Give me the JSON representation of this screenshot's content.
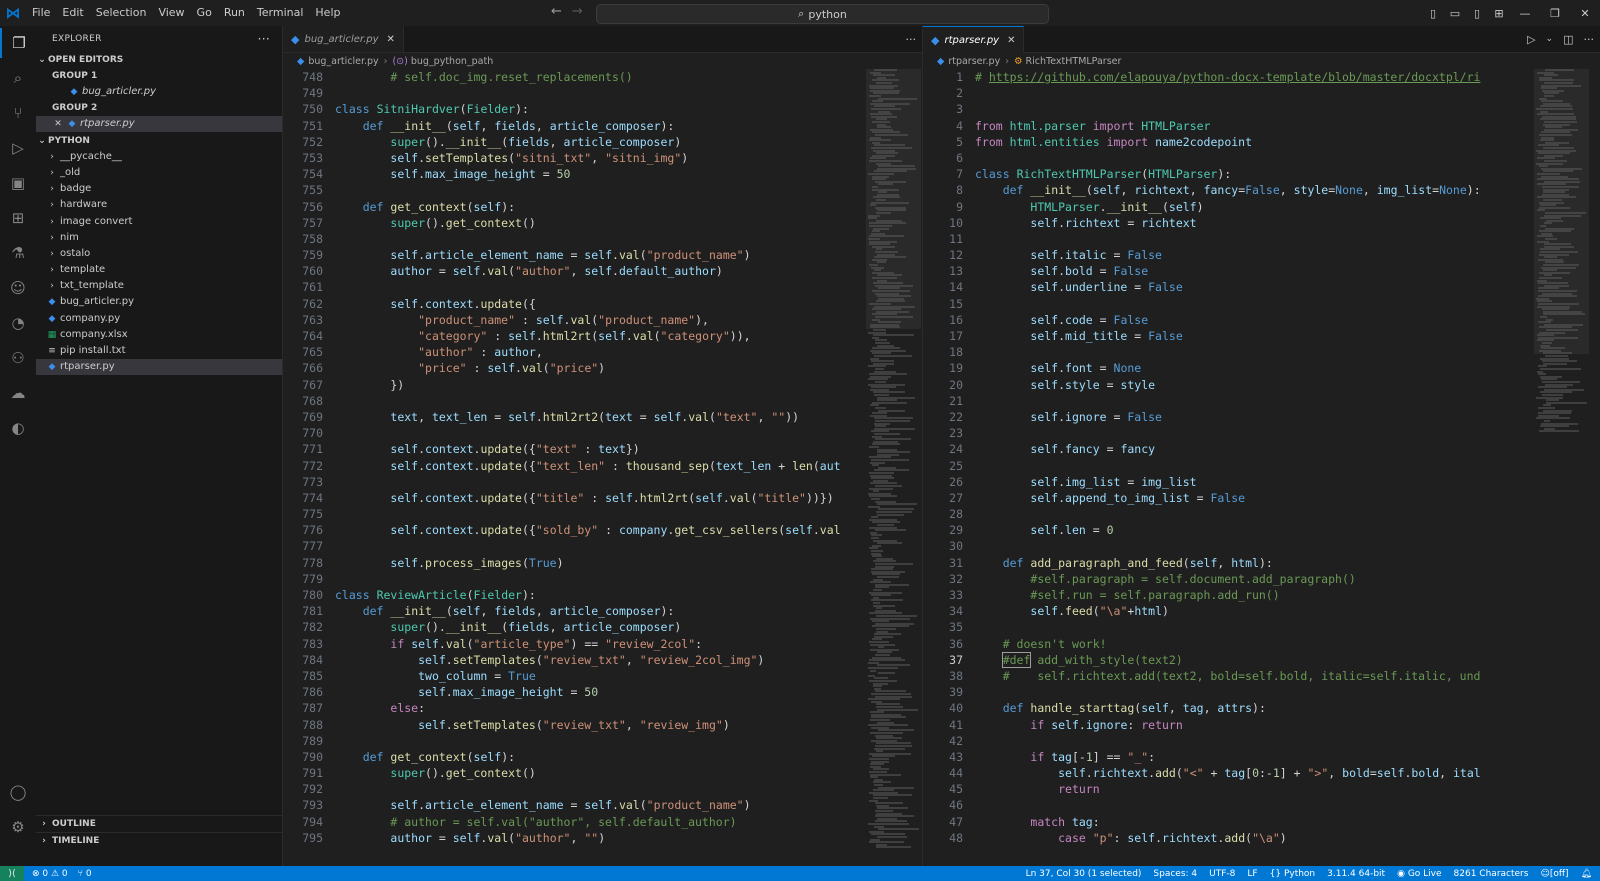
{
  "titlebar": {
    "menus": [
      "File",
      "Edit",
      "Selection",
      "View",
      "Go",
      "Run",
      "Terminal",
      "Help"
    ],
    "search": "python"
  },
  "sidebar": {
    "header": "EXPLORER",
    "open_editors": "OPEN EDITORS",
    "group1": "GROUP 1",
    "group1_file": "bug_articler.py",
    "group2": "GROUP 2",
    "group2_file": "rtparser.py",
    "folder": "PYTHON",
    "tree": [
      {
        "label": "__pycache__",
        "type": "folder"
      },
      {
        "label": "_old",
        "type": "folder"
      },
      {
        "label": "badge",
        "type": "folder"
      },
      {
        "label": "hardware",
        "type": "folder"
      },
      {
        "label": "image convert",
        "type": "folder"
      },
      {
        "label": "nim",
        "type": "folder"
      },
      {
        "label": "ostalo",
        "type": "folder"
      },
      {
        "label": "template",
        "type": "folder"
      },
      {
        "label": "txt_template",
        "type": "folder"
      },
      {
        "label": "bug_articler.py",
        "type": "py"
      },
      {
        "label": "company.py",
        "type": "py"
      },
      {
        "label": "company.xlsx",
        "type": "xlsx"
      },
      {
        "label": "pip install.txt",
        "type": "txt"
      },
      {
        "label": "rtparser.py",
        "type": "py",
        "selected": true
      }
    ],
    "outline": "OUTLINE",
    "timeline": "TIMELINE"
  },
  "left_editor": {
    "tab": "bug_articler.py",
    "crumb_file": "bug_articler.py",
    "crumb_symbol": "bug_python_path",
    "lines": [
      {
        "n": "748",
        "h": "        <span class=\"cm\"># self.doc_img.reset_replacements()</span>"
      },
      {
        "n": "749",
        "h": ""
      },
      {
        "n": "750",
        "h": "<span class=\"k\">class</span> <span class=\"t\">SitniHardver</span>(<span class=\"t\">Fielder</span>):"
      },
      {
        "n": "751",
        "h": "    <span class=\"k\">def</span> <span class=\"f\">__init__</span>(<span class=\"v\">self</span>, <span class=\"v\">fields</span>, <span class=\"v\">article_composer</span>):"
      },
      {
        "n": "752",
        "h": "        <span class=\"t\">super</span>().<span class=\"f\">__init__</span>(<span class=\"v\">fields</span>, <span class=\"v\">article_composer</span>)"
      },
      {
        "n": "753",
        "h": "        <span class=\"v\">self</span>.<span class=\"f\">setTemplates</span>(<span class=\"s\">\"sitni_txt\"</span>, <span class=\"s\">\"sitni_img\"</span>)"
      },
      {
        "n": "754",
        "h": "        <span class=\"v\">self</span>.<span class=\"v\">max_image_height</span> = <span class=\"n\">50</span>"
      },
      {
        "n": "755",
        "h": ""
      },
      {
        "n": "756",
        "h": "    <span class=\"k\">def</span> <span class=\"f\">get_context</span>(<span class=\"v\">self</span>):"
      },
      {
        "n": "757",
        "h": "        <span class=\"t\">super</span>().<span class=\"f\">get_context</span>()"
      },
      {
        "n": "758",
        "h": ""
      },
      {
        "n": "759",
        "h": "        <span class=\"v\">self</span>.<span class=\"v\">article_element_name</span> = <span class=\"v\">self</span>.<span class=\"f\">val</span>(<span class=\"s\">\"product_name\"</span>)"
      },
      {
        "n": "760",
        "h": "        <span class=\"v\">author</span> = <span class=\"v\">self</span>.<span class=\"f\">val</span>(<span class=\"s\">\"author\"</span>, <span class=\"v\">self</span>.<span class=\"v\">default_author</span>)"
      },
      {
        "n": "761",
        "h": ""
      },
      {
        "n": "762",
        "h": "        <span class=\"v\">self</span>.<span class=\"v\">context</span>.<span class=\"f\">update</span>({"
      },
      {
        "n": "763",
        "h": "            <span class=\"s\">\"product_name\"</span> : <span class=\"v\">self</span>.<span class=\"f\">val</span>(<span class=\"s\">\"product_name\"</span>),"
      },
      {
        "n": "764",
        "h": "            <span class=\"s\">\"category\"</span> : <span class=\"v\">self</span>.<span class=\"f\">html2rt</span>(<span class=\"v\">self</span>.<span class=\"f\">val</span>(<span class=\"s\">\"category\"</span>)),"
      },
      {
        "n": "765",
        "h": "            <span class=\"s\">\"author\"</span> : <span class=\"v\">author</span>,"
      },
      {
        "n": "766",
        "h": "            <span class=\"s\">\"price\"</span> : <span class=\"v\">self</span>.<span class=\"f\">val</span>(<span class=\"s\">\"price\"</span>)"
      },
      {
        "n": "767",
        "h": "        })"
      },
      {
        "n": "768",
        "h": ""
      },
      {
        "n": "769",
        "h": "        <span class=\"v\">text</span>, <span class=\"v\">text_len</span> = <span class=\"v\">self</span>.<span class=\"f\">html2rt2</span>(<span class=\"v\">text</span> = <span class=\"v\">self</span>.<span class=\"f\">val</span>(<span class=\"s\">\"text\"</span>, <span class=\"s\">\"\"</span>))"
      },
      {
        "n": "770",
        "h": ""
      },
      {
        "n": "771",
        "h": "        <span class=\"v\">self</span>.<span class=\"v\">context</span>.<span class=\"f\">update</span>({<span class=\"s\">\"text\"</span> : <span class=\"v\">text</span>})"
      },
      {
        "n": "772",
        "h": "        <span class=\"v\">self</span>.<span class=\"v\">context</span>.<span class=\"f\">update</span>({<span class=\"s\">\"text_len\"</span> : <span class=\"f\">thousand_sep</span>(<span class=\"v\">text_len</span> + <span class=\"f\">len</span>(<span class=\"v\">aut</span>"
      },
      {
        "n": "773",
        "h": ""
      },
      {
        "n": "774",
        "h": "        <span class=\"v\">self</span>.<span class=\"v\">context</span>.<span class=\"f\">update</span>({<span class=\"s\">\"title\"</span> : <span class=\"v\">self</span>.<span class=\"f\">html2rt</span>(<span class=\"v\">self</span>.<span class=\"f\">val</span>(<span class=\"s\">\"title\"</span>))})"
      },
      {
        "n": "775",
        "h": ""
      },
      {
        "n": "776",
        "h": "        <span class=\"v\">self</span>.<span class=\"v\">context</span>.<span class=\"f\">update</span>({<span class=\"s\">\"sold_by\"</span> : <span class=\"v\">company</span>.<span class=\"f\">get_csv_sellers</span>(<span class=\"v\">self</span>.<span class=\"f\">val</span>"
      },
      {
        "n": "777",
        "h": ""
      },
      {
        "n": "778",
        "h": "        <span class=\"v\">self</span>.<span class=\"f\">process_images</span>(<span class=\"k\">True</span>)"
      },
      {
        "n": "779",
        "h": ""
      },
      {
        "n": "780",
        "h": "<span class=\"k\">class</span> <span class=\"t\">ReviewArticle</span>(<span class=\"t\">Fielder</span>):"
      },
      {
        "n": "781",
        "h": "    <span class=\"k\">def</span> <span class=\"f\">__init__</span>(<span class=\"v\">self</span>, <span class=\"v\">fields</span>, <span class=\"v\">article_composer</span>):"
      },
      {
        "n": "782",
        "h": "        <span class=\"t\">super</span>().<span class=\"f\">__init__</span>(<span class=\"v\">fields</span>, <span class=\"v\">article_composer</span>)"
      },
      {
        "n": "783",
        "h": "        <span class=\"c\">if</span> <span class=\"v\">self</span>.<span class=\"f\">val</span>(<span class=\"s\">\"article_type\"</span>) == <span class=\"s\">\"review_2col\"</span>:"
      },
      {
        "n": "784",
        "h": "            <span class=\"v\">self</span>.<span class=\"f\">setTemplates</span>(<span class=\"s\">\"review_txt\"</span>, <span class=\"s\">\"review_2col_img\"</span>)"
      },
      {
        "n": "785",
        "h": "            <span class=\"v\">two_column</span> = <span class=\"k\">True</span>"
      },
      {
        "n": "786",
        "h": "            <span class=\"v\">self</span>.<span class=\"v\">max_image_height</span> = <span class=\"n\">50</span>"
      },
      {
        "n": "787",
        "h": "        <span class=\"c\">else</span>:"
      },
      {
        "n": "788",
        "h": "            <span class=\"v\">self</span>.<span class=\"f\">setTemplates</span>(<span class=\"s\">\"review_txt\"</span>, <span class=\"s\">\"review_img\"</span>)"
      },
      {
        "n": "789",
        "h": ""
      },
      {
        "n": "790",
        "h": "    <span class=\"k\">def</span> <span class=\"f\">get_context</span>(<span class=\"v\">self</span>):"
      },
      {
        "n": "791",
        "h": "        <span class=\"t\">super</span>().<span class=\"f\">get_context</span>()"
      },
      {
        "n": "792",
        "h": ""
      },
      {
        "n": "793",
        "h": "        <span class=\"v\">self</span>.<span class=\"v\">article_element_name</span> = <span class=\"v\">self</span>.<span class=\"f\">val</span>(<span class=\"s\">\"product_name\"</span>)"
      },
      {
        "n": "794",
        "h": "        <span class=\"cm\"># author = self.val(\"author\", self.default_author)</span>"
      },
      {
        "n": "795",
        "h": "        <span class=\"v\">author</span> = <span class=\"v\">self</span>.<span class=\"f\">val</span>(<span class=\"s\">\"author\"</span>, <span class=\"s\">\"\"</span>)"
      }
    ]
  },
  "right_editor": {
    "tab": "rtparser.py",
    "crumb_file": "rtparser.py",
    "crumb_symbol": "RichTextHTMLParser",
    "lines": [
      {
        "n": "1",
        "h": "<span class=\"cm\"># <u>https://github.com/elapouya/python-docx-template/blob/master/docxtpl/ri</u></span>"
      },
      {
        "n": "2",
        "h": ""
      },
      {
        "n": "3",
        "h": ""
      },
      {
        "n": "4",
        "h": "<span class=\"c\">from</span> <span class=\"t\">html.parser</span> <span class=\"c\">import</span> <span class=\"t\">HTMLParser</span>"
      },
      {
        "n": "5",
        "h": "<span class=\"c\">from</span> <span class=\"t\">html.entities</span> <span class=\"c\">import</span> <span class=\"v\">name2codepoint</span>"
      },
      {
        "n": "6",
        "h": ""
      },
      {
        "n": "7",
        "h": "<span class=\"k\">class</span> <span class=\"t\">RichTextHTMLParser</span>(<span class=\"t\">HTMLParser</span>):"
      },
      {
        "n": "8",
        "h": "    <span class=\"k\">def</span> <span class=\"f\">__init__</span>(<span class=\"v\">self</span>, <span class=\"v\">richtext</span>, <span class=\"v\">fancy</span>=<span class=\"k\">False</span>, <span class=\"v\">style</span>=<span class=\"k\">None</span>, <span class=\"v\">img_list</span>=<span class=\"k\">None</span>):"
      },
      {
        "n": "9",
        "h": "        <span class=\"t\">HTMLParser</span>.<span class=\"f\">__init__</span>(<span class=\"v\">self</span>)"
      },
      {
        "n": "10",
        "h": "        <span class=\"v\">self</span>.<span class=\"v\">richtext</span> = <span class=\"v\">richtext</span>"
      },
      {
        "n": "11",
        "h": ""
      },
      {
        "n": "12",
        "h": "        <span class=\"v\">self</span>.<span class=\"v\">italic</span> = <span class=\"k\">False</span>"
      },
      {
        "n": "13",
        "h": "        <span class=\"v\">self</span>.<span class=\"v\">bold</span> = <span class=\"k\">False</span>"
      },
      {
        "n": "14",
        "h": "        <span class=\"v\">self</span>.<span class=\"v\">underline</span> = <span class=\"k\">False</span>"
      },
      {
        "n": "15",
        "h": ""
      },
      {
        "n": "16",
        "h": "        <span class=\"v\">self</span>.<span class=\"v\">code</span> = <span class=\"k\">False</span>"
      },
      {
        "n": "17",
        "h": "        <span class=\"v\">self</span>.<span class=\"v\">mid_title</span> = <span class=\"k\">False</span>"
      },
      {
        "n": "18",
        "h": ""
      },
      {
        "n": "19",
        "h": "        <span class=\"v\">self</span>.<span class=\"v\">font</span> = <span class=\"k\">None</span>"
      },
      {
        "n": "20",
        "h": "        <span class=\"v\">self</span>.<span class=\"v\">style</span> = <span class=\"v\">style</span>"
      },
      {
        "n": "21",
        "h": ""
      },
      {
        "n": "22",
        "h": "        <span class=\"v\">self</span>.<span class=\"v\">ignore</span> = <span class=\"k\">False</span>"
      },
      {
        "n": "23",
        "h": ""
      },
      {
        "n": "24",
        "h": "        <span class=\"v\">self</span>.<span class=\"v\">fancy</span> = <span class=\"v\">fancy</span>"
      },
      {
        "n": "25",
        "h": ""
      },
      {
        "n": "26",
        "h": "        <span class=\"v\">self</span>.<span class=\"v\">img_list</span> = <span class=\"v\">img_list</span>"
      },
      {
        "n": "27",
        "h": "        <span class=\"v\">self</span>.<span class=\"v\">append_to_img_list</span> = <span class=\"k\">False</span>"
      },
      {
        "n": "28",
        "h": ""
      },
      {
        "n": "29",
        "h": "        <span class=\"v\">self</span>.<span class=\"v\">len</span> = <span class=\"n\">0</span>"
      },
      {
        "n": "30",
        "h": ""
      },
      {
        "n": "31",
        "h": "    <span class=\"k\">def</span> <span class=\"f\">add_paragraph_and_feed</span>(<span class=\"v\">self</span>, <span class=\"v\">html</span>):"
      },
      {
        "n": "32",
        "h": "        <span class=\"cm\">#self.paragraph = self.document.add_paragraph()</span>"
      },
      {
        "n": "33",
        "h": "        <span class=\"cm\">#self.run = self.paragraph.add_run()</span>"
      },
      {
        "n": "34",
        "h": "        <span class=\"v\">self</span>.<span class=\"f\">feed</span>(<span class=\"s\">\"\\a\"</span>+<span class=\"v\">html</span>)"
      },
      {
        "n": "35",
        "h": ""
      },
      {
        "n": "36",
        "h": "    <span class=\"cm\"># doesn't work!</span>"
      },
      {
        "n": "37",
        "h": "    <span class=\"cm\"><span class=\"hl\">#def</span> add_with_style(text2)</span>",
        "cur": true
      },
      {
        "n": "38",
        "h": "    <span class=\"cm\">#    self.richtext.add(text2, bold=self.bold, italic=self.italic, und</span>"
      },
      {
        "n": "39",
        "h": ""
      },
      {
        "n": "40",
        "h": "    <span class=\"k\">def</span> <span class=\"f\">handle_starttag</span>(<span class=\"v\">self</span>, <span class=\"v\">tag</span>, <span class=\"v\">attrs</span>):"
      },
      {
        "n": "41",
        "h": "        <span class=\"c\">if</span> <span class=\"v\">self</span>.<span class=\"v\">ignore</span>: <span class=\"c\">return</span>"
      },
      {
        "n": "42",
        "h": ""
      },
      {
        "n": "43",
        "h": "        <span class=\"c\">if</span> <span class=\"v\">tag</span>[-<span class=\"n\">1</span>] == <span class=\"s\">\"_\"</span>:"
      },
      {
        "n": "44",
        "h": "            <span class=\"v\">self</span>.<span class=\"v\">richtext</span>.<span class=\"f\">add</span>(<span class=\"s\">\"&lt;\"</span> + <span class=\"v\">tag</span>[<span class=\"n\">0</span>:-<span class=\"n\">1</span>] + <span class=\"s\">\"&gt;\"</span>, <span class=\"v\">bold</span>=<span class=\"v\">self</span>.<span class=\"v\">bold</span>, <span class=\"v\">ital</span>"
      },
      {
        "n": "45",
        "h": "            <span class=\"c\">return</span>"
      },
      {
        "n": "46",
        "h": ""
      },
      {
        "n": "47",
        "h": "        <span class=\"c\">match</span> <span class=\"v\">tag</span>:"
      },
      {
        "n": "48",
        "h": "            <span class=\"c\">case</span> <span class=\"s\">\"p\"</span>: <span class=\"v\">self</span>.<span class=\"v\">richtext</span>.<span class=\"f\">add</span>(<span class=\"s\">\"\\a\"</span>)"
      }
    ]
  },
  "statusbar": {
    "errors": "⊗ 0 ⚠ 0",
    "ports": "⑂ 0",
    "position": "Ln 37, Col 30 (1 selected)",
    "spaces": "Spaces: 4",
    "encoding": "UTF-8",
    "eol": "LF",
    "language": "Python",
    "interpreter": "3.11.4 64-bit",
    "golive": "Go Live",
    "chars": "8261 Characters",
    "off": "[off]"
  },
  "icons": {
    "explorer": "files-icon",
    "search": "search-icon",
    "scm": "source-control-icon",
    "run": "run-debug-icon",
    "remote": "remote-explorer-icon",
    "extensions": "extensions-icon",
    "testing": "flask-icon",
    "copilot": "copilot-icon",
    "gitlens": "gitlens-icon",
    "python": "python-icon",
    "docker": "docker-icon",
    "edge": "edge-icon",
    "account": "account-icon",
    "settings": "gear-icon"
  }
}
